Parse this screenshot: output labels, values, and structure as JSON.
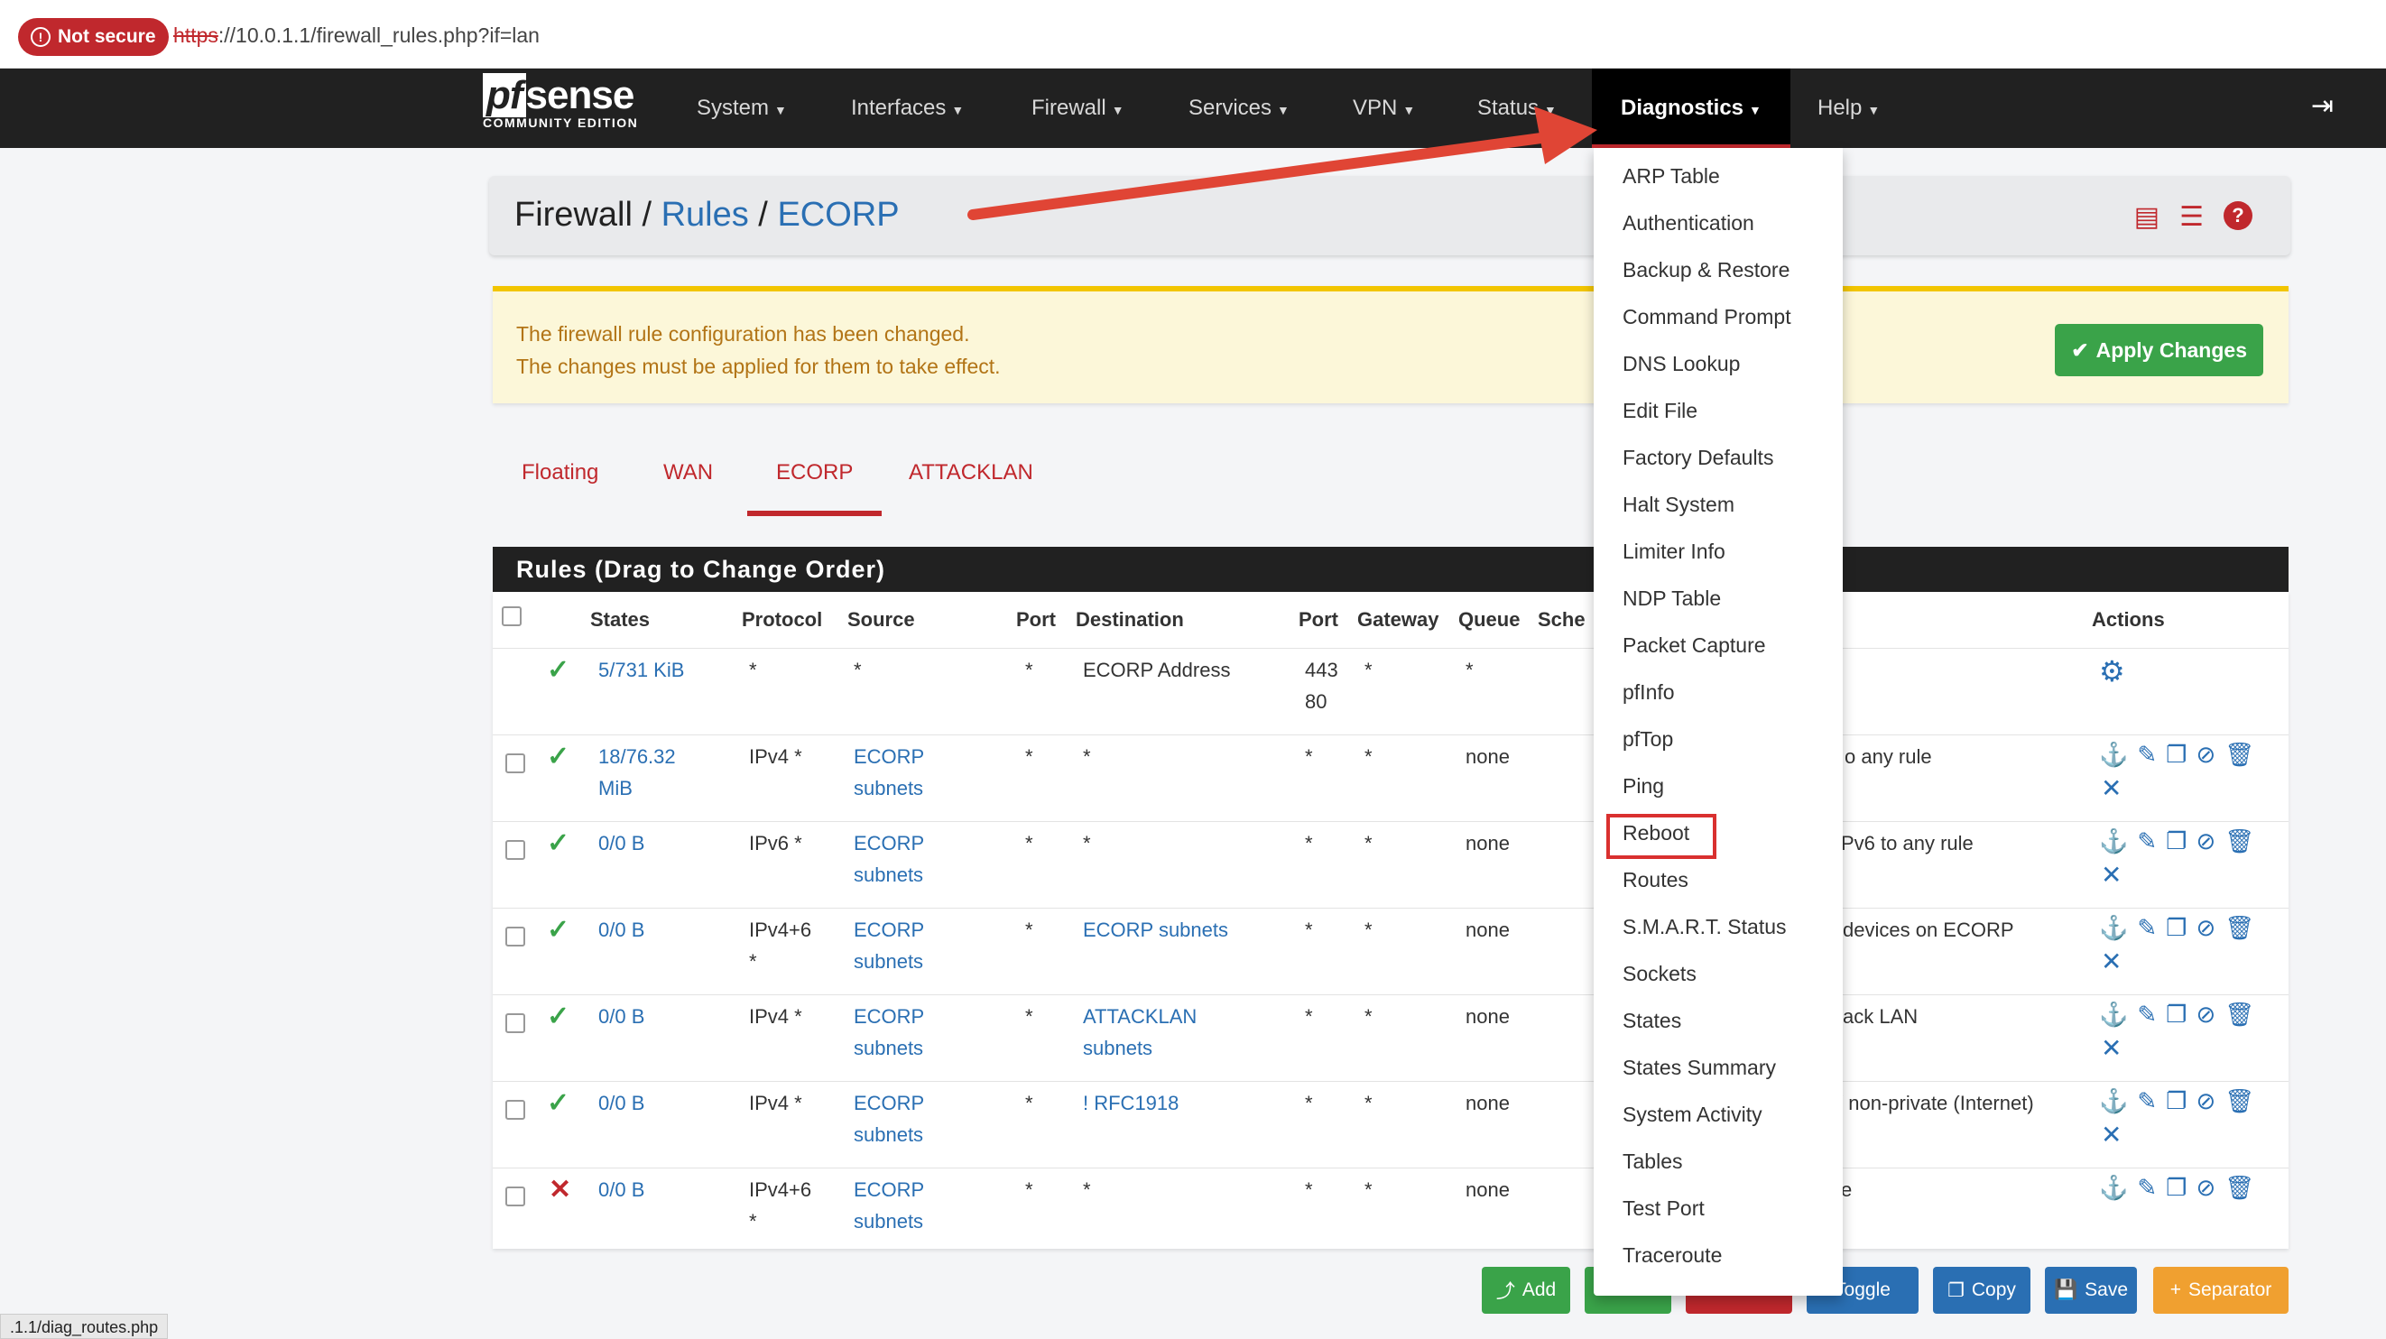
{
  "browser": {
    "not_secure": "Not secure",
    "url_scheme": "https",
    "url_rest": "://10.0.1.1/firewall_rules.php?if=lan"
  },
  "logo": {
    "pf": "pf",
    "sense": "sense",
    "edition": "COMMUNITY EDITION"
  },
  "nav": [
    "System",
    "Interfaces",
    "Firewall",
    "Services",
    "VPN",
    "Status",
    "Diagnostics",
    "Help"
  ],
  "breadcrumb": {
    "root": "Firewall",
    "sep": " / ",
    "rules": "Rules",
    "current": "ECORP"
  },
  "alert": {
    "line1": "The firewall rule configuration has been changed.",
    "line2": "The changes must be applied for them to take effect.",
    "apply": "Apply Changes"
  },
  "tabs": [
    "Floating",
    "WAN",
    "ECORP",
    "ATTACKLAN"
  ],
  "rules": {
    "title": "Rules (Drag to Change Order)",
    "headers": [
      "States",
      "Protocol",
      "Source",
      "Port",
      "Destination",
      "Port",
      "Gateway",
      "Queue",
      "Sche",
      "Actions"
    ],
    "rows": [
      {
        "states": "5/731 KiB",
        "states2": "",
        "protocol": "*",
        "protocol2": "",
        "source": "*",
        "source2": "",
        "port": "*",
        "dest": "ECORP Address",
        "dest2": "",
        "dport": "443",
        "dport2": "80",
        "gateway": "*",
        "queue": "*",
        "desc": ""
      },
      {
        "states": "18/76.32",
        "states2": "MiB",
        "protocol": "IPv4 *",
        "protocol2": "",
        "source": "ECORP",
        "source2": "subnets",
        "port": "*",
        "dest": "*",
        "dest2": "",
        "dport": "*",
        "dport2": "",
        "gateway": "*",
        "queue": "none",
        "desc": "o any rule"
      },
      {
        "states": "0/0 B",
        "states2": "",
        "protocol": "IPv6 *",
        "protocol2": "",
        "source": "ECORP",
        "source2": "subnets",
        "port": "*",
        "dest": "*",
        "dest2": "",
        "dport": "*",
        "dport2": "",
        "gateway": "*",
        "queue": "none",
        "desc": "Pv6 to any rule"
      },
      {
        "states": "0/0 B",
        "states2": "",
        "protocol": "IPv4+6",
        "protocol2": "*",
        "source": "ECORP",
        "source2": "subnets",
        "port": "*",
        "dest": "ECORP subnets",
        "dest2": "",
        "dport": "*",
        "dport2": "",
        "gateway": "*",
        "queue": "none",
        "desc": "devices on ECORP"
      },
      {
        "states": "0/0 B",
        "states2": "",
        "protocol": "IPv4 *",
        "protocol2": "",
        "source": "ECORP",
        "source2": "subnets",
        "port": "*",
        "dest": "ATTACKLAN",
        "dest2": "subnets",
        "dport": "*",
        "dport2": "",
        "gateway": "*",
        "queue": "none",
        "desc": "ack LAN"
      },
      {
        "states": "0/0 B",
        "states2": "",
        "protocol": "IPv4 *",
        "protocol2": "",
        "source": "ECORP",
        "source2": "subnets",
        "port": "*",
        "dest": "! RFC1918",
        "dest2": "",
        "dport": "*",
        "dport2": "",
        "gateway": "*",
        "queue": "none",
        "desc": "/ non-private (Internet)"
      },
      {
        "states": "0/0 B",
        "states2": "",
        "protocol": "IPv4+6",
        "protocol2": "*",
        "source": "ECORP",
        "source2": "subnets",
        "port": "*",
        "dest": "*",
        "dest2": "",
        "dport": "*",
        "dport2": "",
        "gateway": "*",
        "queue": "none",
        "desc": "e"
      }
    ]
  },
  "diagnostics_menu": [
    "ARP Table",
    "Authentication",
    "Backup & Restore",
    "Command Prompt",
    "DNS Lookup",
    "Edit File",
    "Factory Defaults",
    "Halt System",
    "Limiter Info",
    "NDP Table",
    "Packet Capture",
    "pfInfo",
    "pfTop",
    "Ping",
    "Reboot",
    "Routes",
    "S.M.A.R.T. Status",
    "Sockets",
    "States",
    "States Summary",
    "System Activity",
    "Tables",
    "Test Port",
    "Traceroute"
  ],
  "buttons": {
    "add": "Add",
    "toggle": "Toggle",
    "copy": "Copy",
    "save": "Save",
    "separator": "Separator"
  },
  "status_url": ".1.1/diag_routes.php",
  "colors": {
    "accent_red": "#c0282d",
    "link_blue": "#2a6fb3",
    "success_green": "#3aa349",
    "navbar": "#212121"
  }
}
